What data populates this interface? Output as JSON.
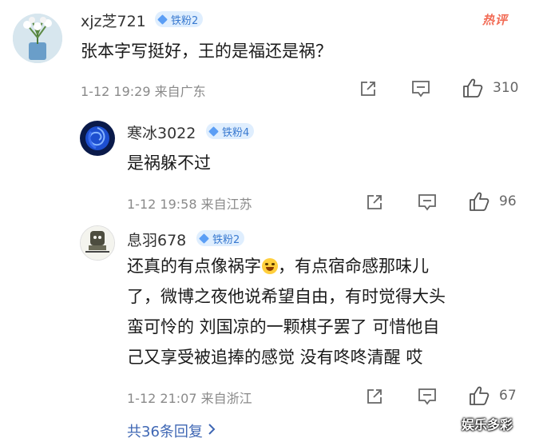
{
  "colors": {
    "accent": "#3a7ad0",
    "hot": "#f26b55",
    "link": "#3f67b4",
    "meta": "#8a8a8a"
  },
  "main_comment": {
    "username": "xjz芝721",
    "badge": "铁粉2",
    "hot_label": "热评",
    "text": "张本字写挺好，王的是福还是祸？",
    "time_location": "1-12 19:29  来自广东",
    "likes": "310"
  },
  "replies": [
    {
      "username": "寒冰3022",
      "badge": "铁粉4",
      "lines": [
        "是祸躲不过"
      ],
      "time_location": "1-12 19:58  来自江苏",
      "likes": "96"
    },
    {
      "username": "息羽678",
      "badge": "铁粉2",
      "lines": [
        "还真的有点像祸字",
        "，有点宿命感那味儿",
        "了，微博之夜他说希望自由，有时觉得大头",
        "蛮可怜的 刘国凉的一颗棋子罢了 可惜他自",
        "己又享受被追捧的感觉 没有咚咚清醒 哎"
      ],
      "time_location": "1-12 21:07  来自浙江",
      "likes": "67"
    }
  ],
  "more_replies": "共36条回复",
  "watermark": "娱乐多彩",
  "icons": [
    "share-icon",
    "comment-icon",
    "like-icon",
    "chevron-right-icon"
  ]
}
